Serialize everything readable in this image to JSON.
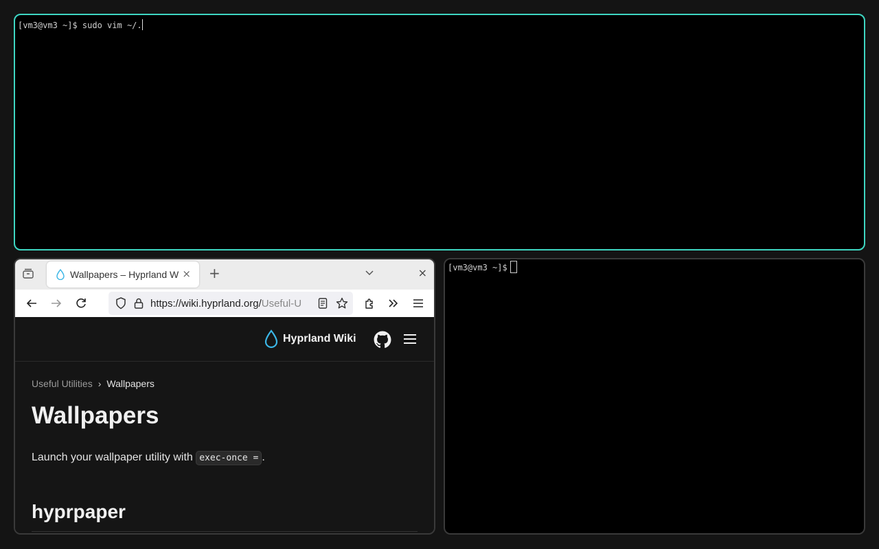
{
  "terminal_top": {
    "prompt": "[vm3@vm3 ~]$ ",
    "command": "sudo vim ~/."
  },
  "terminal_right": {
    "prompt": "[vm3@vm3 ~]$"
  },
  "browser": {
    "tab": {
      "title": "Wallpapers – Hyprland W",
      "close": "×"
    },
    "new_tab": "+",
    "window_close": "×",
    "url": {
      "main": "https://wiki.hyprland.org/",
      "rest": "Useful-U"
    },
    "site": {
      "title": "Hyprland Wiki"
    },
    "breadcrumb": {
      "parent": "Useful Utilities",
      "separator": "›",
      "current": "Wallpapers"
    },
    "heading": "Wallpapers",
    "paragraph_before": "Launch your wallpaper utility with ",
    "paragraph_code": "exec-once =",
    "paragraph_after": ".",
    "subheading": "hyprpaper"
  },
  "colors": {
    "active_border_start": "#33ccff",
    "active_border_end": "#33ffaa",
    "inactive_border": "#3a3a3a",
    "logo": "#3bb6e6"
  }
}
